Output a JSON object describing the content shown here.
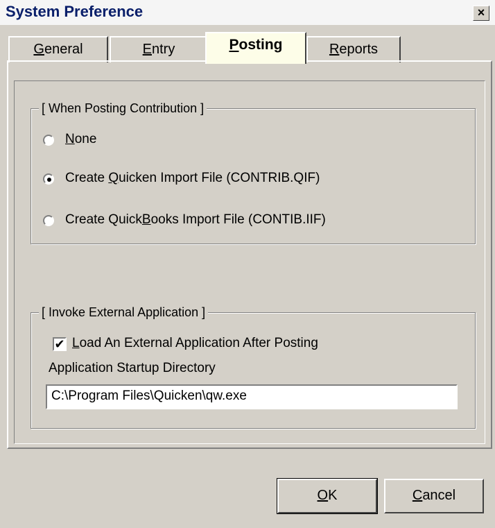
{
  "window": {
    "title": "System Preference",
    "close_label": "×"
  },
  "tabs": [
    {
      "pre": "",
      "key": "G",
      "post": "eneral"
    },
    {
      "pre": "",
      "key": "E",
      "post": "ntry"
    },
    {
      "pre": "",
      "key": "P",
      "post": "osting"
    },
    {
      "pre": "",
      "key": "R",
      "post": "eports"
    }
  ],
  "active_tab": "Posting",
  "contribution_group": {
    "legend": "[ When Posting Contribution  ]",
    "options": [
      {
        "pre": "",
        "key": "N",
        "post": "one",
        "selected": false
      },
      {
        "pre": "Create ",
        "key": "Q",
        "post": "uicken Import File (CONTRIB.QIF)",
        "selected": true
      },
      {
        "pre": "Create Quick",
        "key": "B",
        "post": "ooks Import File (CONTIB.IIF)",
        "selected": false
      }
    ]
  },
  "external_group": {
    "legend": "[ Invoke External Application ]",
    "checkbox": {
      "pre": "",
      "key": "L",
      "post": "oad An External Application After Posting",
      "checked": true,
      "mark": "✔"
    },
    "dir_label": "Application Startup Directory",
    "dir_value": "C:\\Program Files\\Quicken\\qw.exe"
  },
  "buttons": {
    "ok": {
      "pre": "",
      "key": "O",
      "post": "K"
    },
    "cancel": {
      "pre": "",
      "key": "C",
      "post": "ancel"
    }
  },
  "colors": {
    "title_text": "#0a1f6a",
    "face": "#d4d0c8",
    "active_tab": "#fdfde8"
  }
}
